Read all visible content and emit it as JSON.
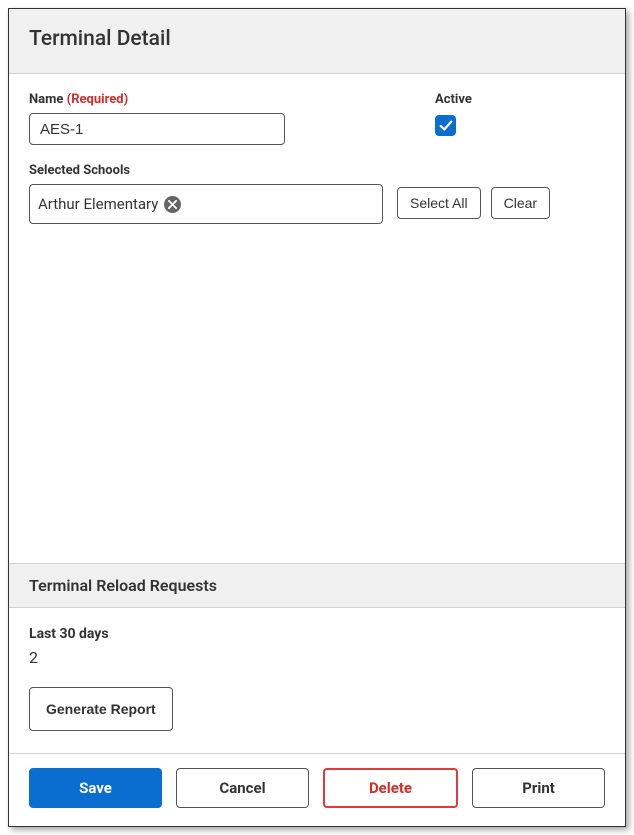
{
  "header": {
    "title": "Terminal Detail"
  },
  "form": {
    "name_label": "Name",
    "required_text": "(Required)",
    "name_value": "AES-1",
    "active_label": "Active",
    "active_checked": true,
    "schools_label": "Selected Schools",
    "schools_selected": [
      "Arthur Elementary"
    ],
    "select_all_label": "Select All",
    "clear_label": "Clear"
  },
  "reload": {
    "section_title": "Terminal Reload Requests",
    "stat_label": "Last 30 days",
    "stat_value": "2",
    "generate_label": "Generate Report"
  },
  "footer": {
    "save": "Save",
    "cancel": "Cancel",
    "delete": "Delete",
    "print": "Print"
  },
  "colors": {
    "primary": "#0a6ed1",
    "danger": "#d12b2b"
  }
}
